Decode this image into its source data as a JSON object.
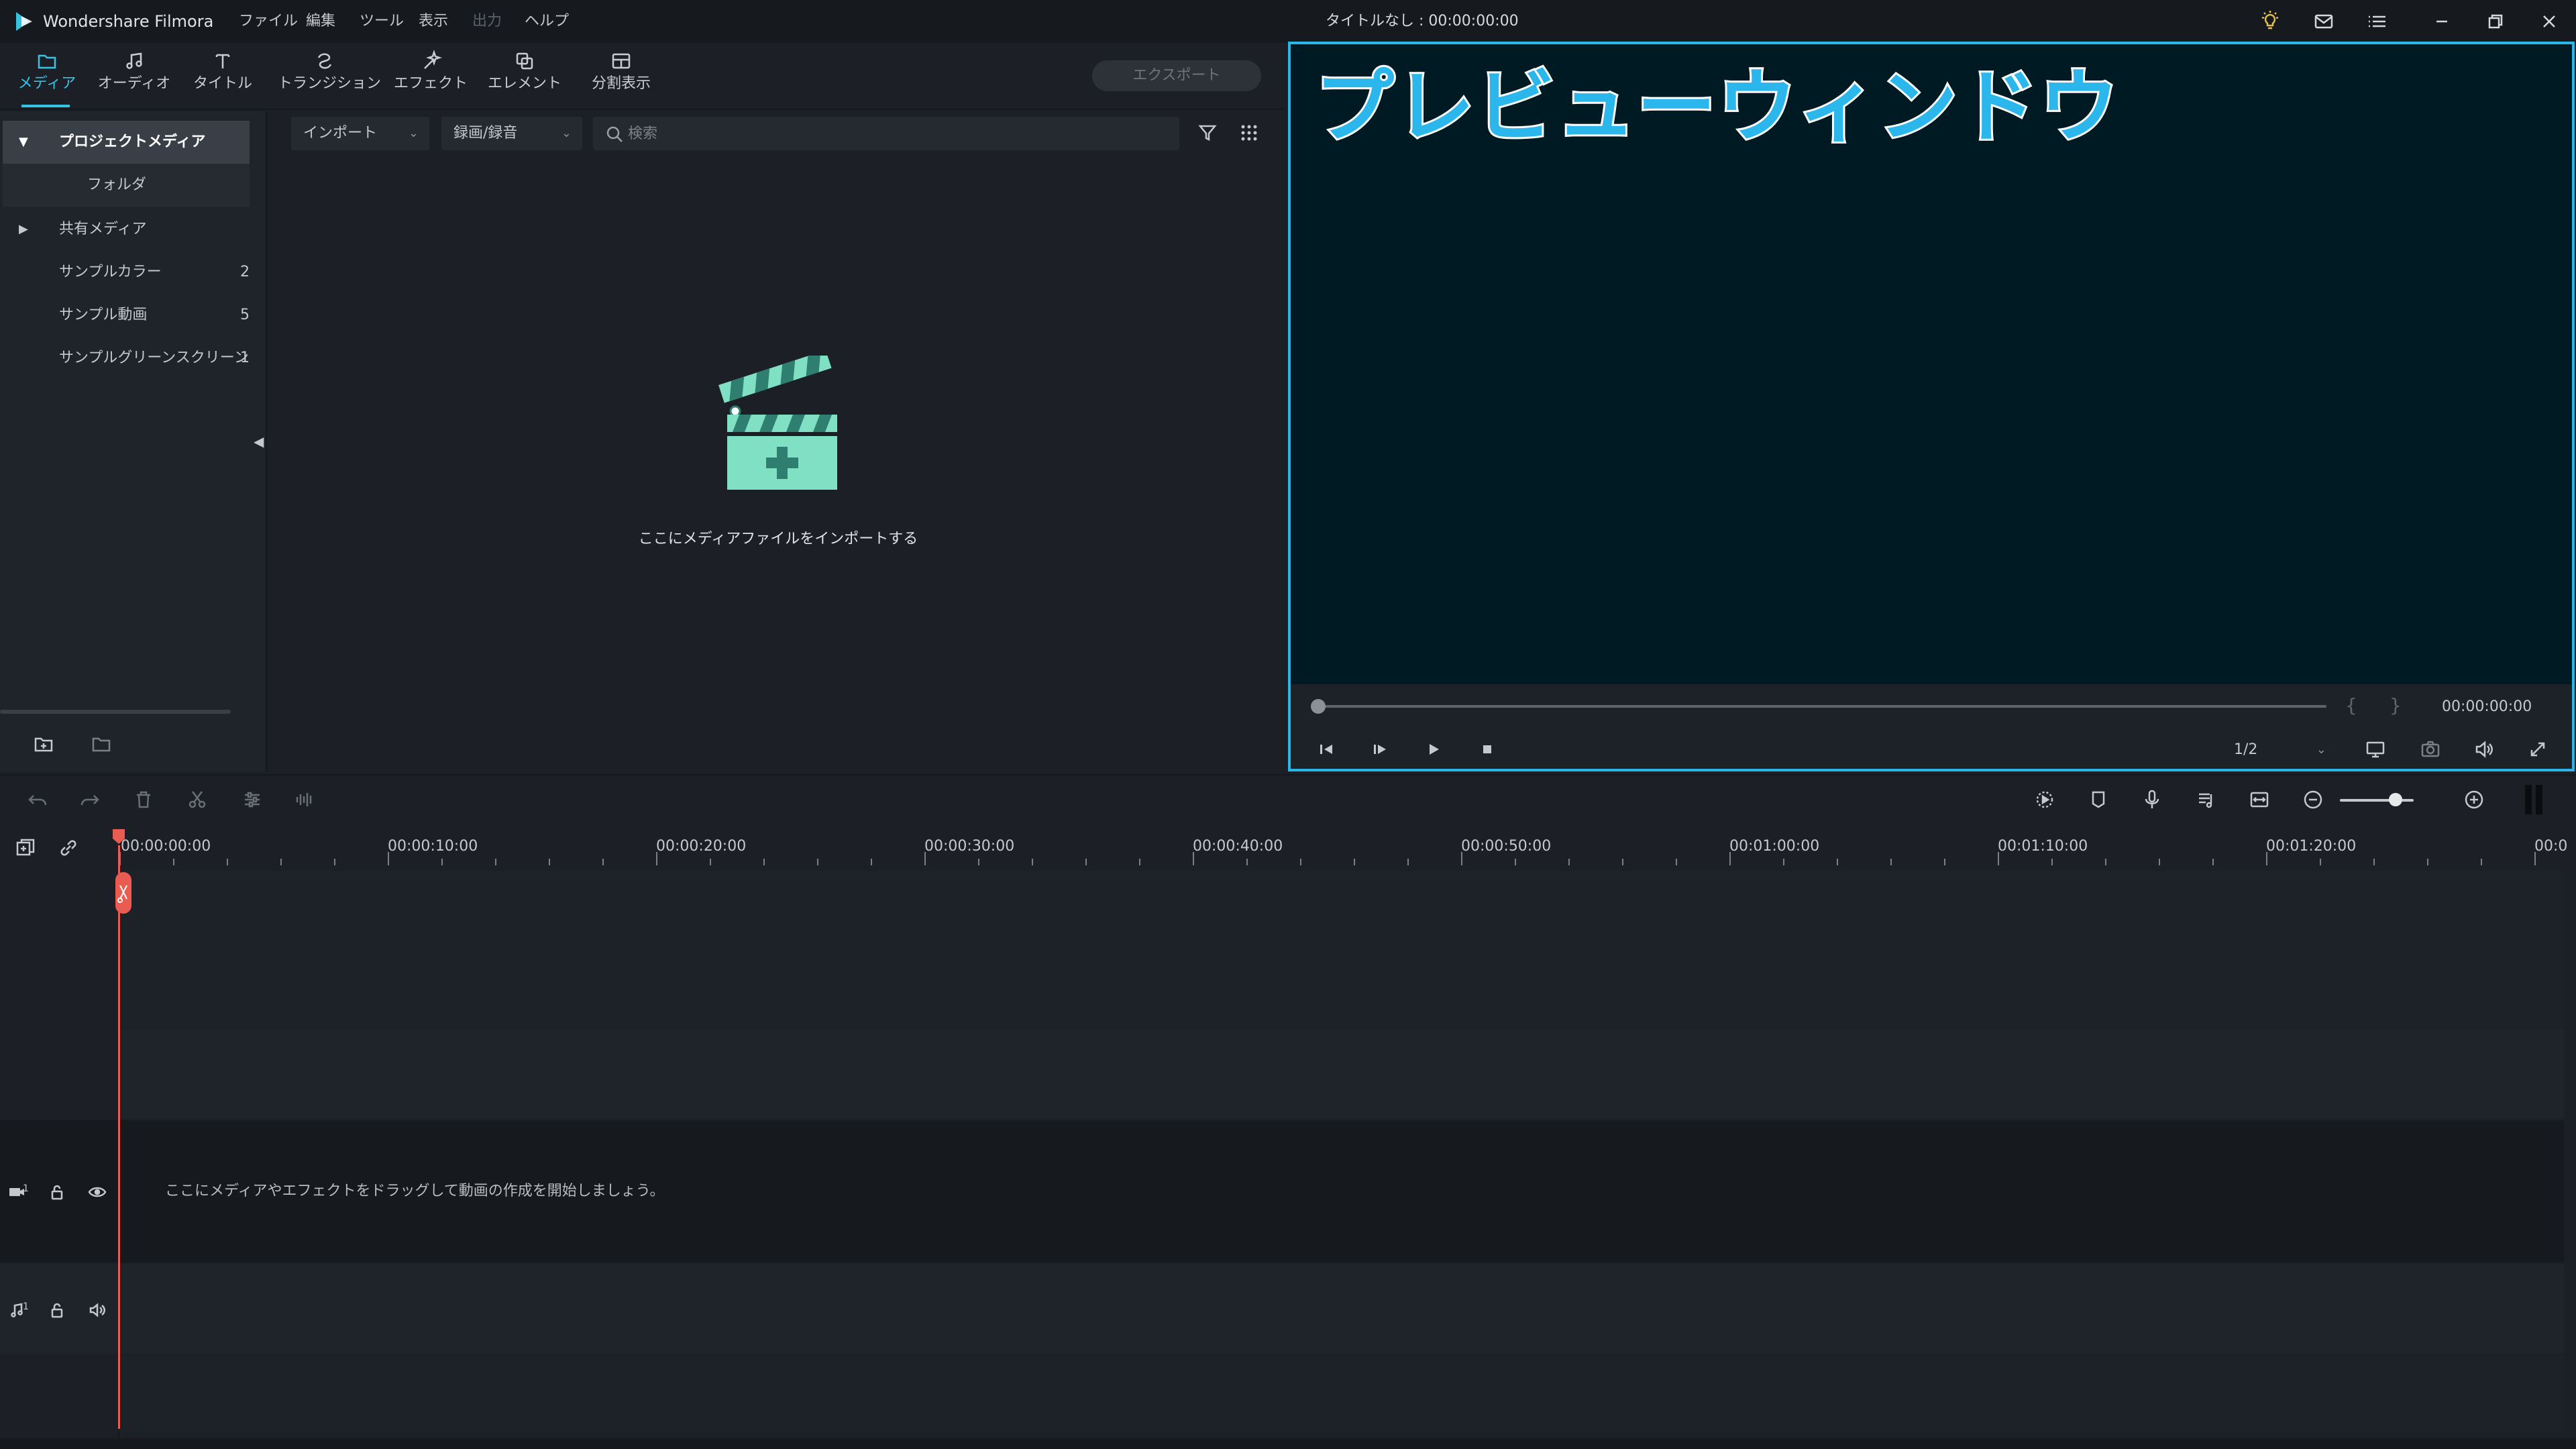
{
  "app": {
    "name": "Wondershare Filmora",
    "document_title": "タイトルなし : 00:00:00:00"
  },
  "menu": [
    "ファイル",
    "編集",
    "ツール",
    "表示",
    "出力",
    "ヘルプ"
  ],
  "titlebar_icons": [
    "bulb-icon",
    "mail-icon",
    "list-icon",
    "minimize-icon",
    "restore-icon",
    "close-icon"
  ],
  "tabs": [
    {
      "label": "メディア",
      "icon": "folder-icon",
      "active": true
    },
    {
      "label": "オーディオ",
      "icon": "music-note-icon"
    },
    {
      "label": "タイトル",
      "icon": "text-icon"
    },
    {
      "label": "トランジション",
      "icon": "transition-icon"
    },
    {
      "label": "エフェクト",
      "icon": "effects-icon"
    },
    {
      "label": "エレメント",
      "icon": "elements-icon"
    },
    {
      "label": "分割表示",
      "icon": "split-screen-icon"
    }
  ],
  "export_label": "エクスポート",
  "sidebar": {
    "items": [
      {
        "label": "プロジェクトメディア",
        "count": ""
      },
      {
        "label": "フォルダ",
        "count": ""
      },
      {
        "label": "共有メディア",
        "count": ""
      },
      {
        "label": "サンプルカラー",
        "count": "2"
      },
      {
        "label": "サンプル動画",
        "count": "5"
      },
      {
        "label": "サンプルグリーンスクリーン",
        "count": "1"
      }
    ]
  },
  "media": {
    "import_dropdown": "インポート",
    "record_dropdown": "録画/録音",
    "search_placeholder": "検索",
    "import_hint": "ここにメディアファイルをインポートする"
  },
  "preview": {
    "overlay_title": "プレビューウィンドウ",
    "time": "00:00:00:00",
    "quality": "1/2",
    "brace_open": "{",
    "brace_close": "}",
    "scrub_progress": 0
  },
  "timeline": {
    "ruler_labels": [
      "00:00:00:00",
      "00:00:10:00",
      "00:00:20:00",
      "00:00:30:00",
      "00:00:40:00",
      "00:00:50:00",
      "00:01:00:00",
      "00:01:10:00",
      "00:01:20:00",
      "00:0"
    ],
    "video_track_hint": "ここにメディアやエフェクトをドラッグして動画の作成を開始しましょう。",
    "video_track_number": "1",
    "audio_track_number": "1",
    "zoom_level": 0.75
  },
  "colors": {
    "accent": "#33c4e6",
    "preview_border": "#29b6e8",
    "preview_bg": "#001a23",
    "playhead": "#ea5b52",
    "clapper": "#7fe0c4"
  }
}
